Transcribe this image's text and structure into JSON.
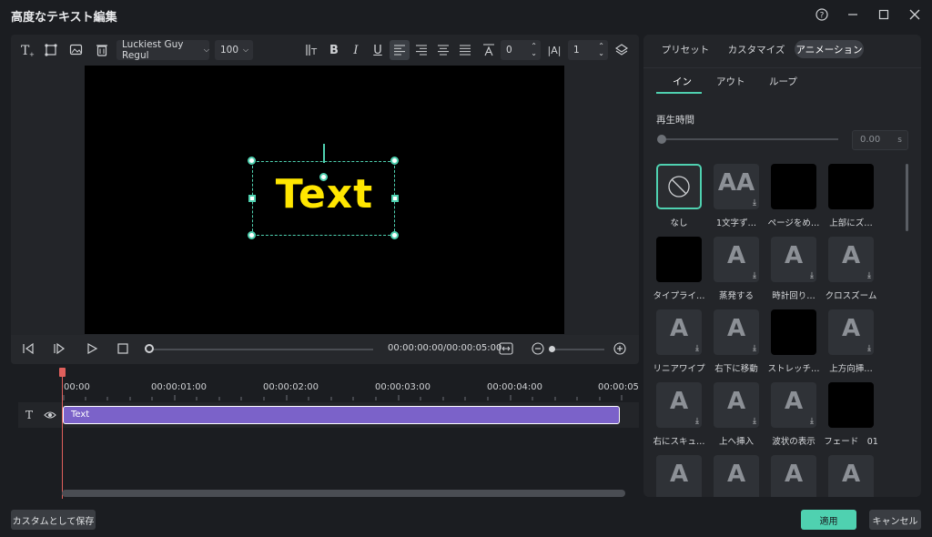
{
  "window": {
    "title": "高度なテキスト編集"
  },
  "toolbar": {
    "font_name": "Luckiest Guy Regul",
    "font_size": "100",
    "spacing_value": "0",
    "line_value": "1"
  },
  "canvas": {
    "text": "Text"
  },
  "playback": {
    "timecode": "00:00:00:00/00:00:05:00"
  },
  "timeline": {
    "ticks": [
      "00:00",
      "00:00:01:00",
      "00:00:02:00",
      "00:00:03:00",
      "00:00:04:00",
      "00:00:05"
    ],
    "clip_label": "Text"
  },
  "right_panel": {
    "tabs": [
      "プリセット",
      "カスタマイズ",
      "アニメーション"
    ],
    "subtabs": [
      "イン",
      "アウト",
      "ループ"
    ],
    "duration_label": "再生時間",
    "duration_value": "0.00",
    "duration_unit": "s",
    "effects": [
      "なし",
      "1文字ず…",
      "ページをめ…",
      "上部にズ…",
      "タイプライ…",
      "蒸発する",
      "時計回り…",
      "クロスズーム",
      "リニアワイプ",
      "右下に移動",
      "ストレッチ…",
      "上方向挿…",
      "右にスキュ…",
      "上へ挿入",
      "波状の表示",
      "フェード　01",
      "",
      "",
      "",
      ""
    ]
  },
  "footer": {
    "save_custom": "カスタムとして保存",
    "apply": "適用",
    "cancel": "キャンセル"
  },
  "colors": {
    "accent": "#4fd1b0",
    "clip": "#7b62c9",
    "text_yellow": "#ffe600"
  }
}
